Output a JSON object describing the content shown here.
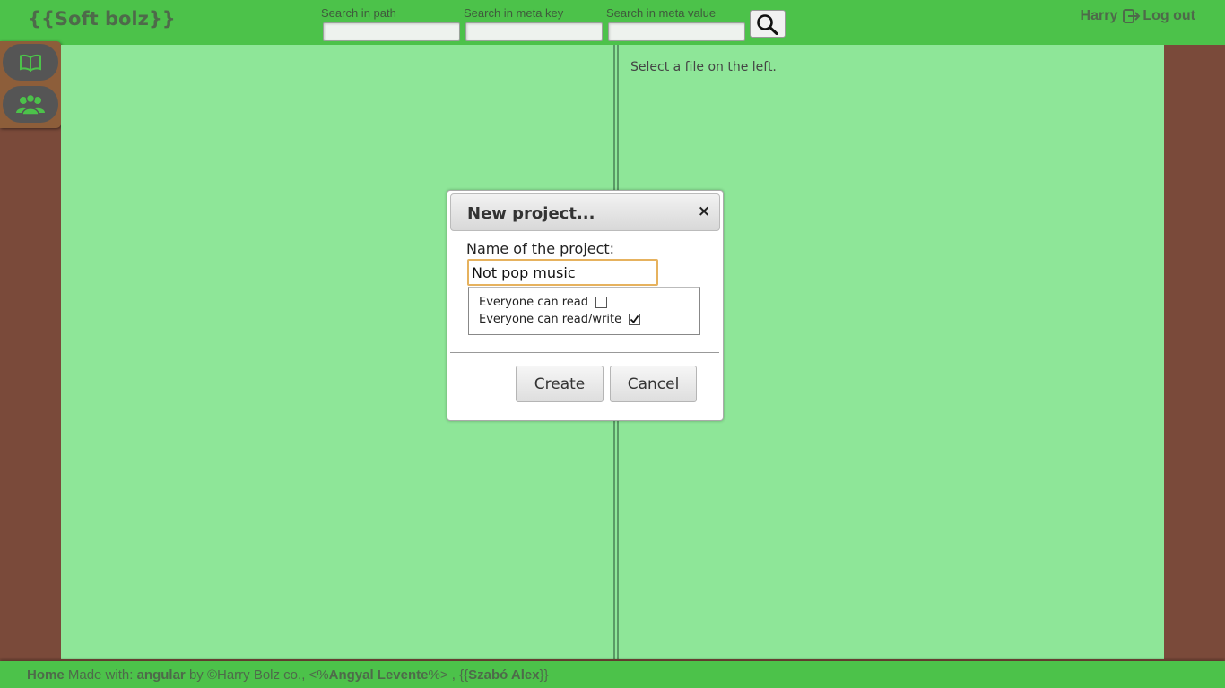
{
  "app": {
    "logo": "{{Soft bolz}}"
  },
  "header": {
    "search_path_label": "Search in path",
    "search_key_label": "Search in meta key",
    "search_value_label": "Search in meta value",
    "search_path_value": "",
    "search_key_value": "",
    "search_value_value": "",
    "search_icon": "search-icon",
    "user_name": "Harry",
    "logout_icon": "logout-icon",
    "logout_label": "Log out"
  },
  "sidebar": {
    "items": [
      {
        "icon": "book-icon"
      },
      {
        "icon": "users-icon"
      }
    ]
  },
  "main": {
    "right_hint": "Select a file on the left."
  },
  "modal": {
    "title": "New project...",
    "close_label": "×",
    "name_label": "Name of the project:",
    "name_value": "Not pop music",
    "options": [
      {
        "label": "Everyone can read",
        "checked": false
      },
      {
        "label": "Everyone can read/write",
        "checked": true
      }
    ],
    "create_label": "Create",
    "cancel_label": "Cancel"
  },
  "footer": {
    "home": "Home",
    "made_with": "Made with:",
    "framework": "angular",
    "by": "by ©Harry Bolz co., <%",
    "author1": "Angyal Levente",
    "sep": "%> , {{",
    "author2": "Szabó Alex",
    "end": "}}"
  },
  "colors": {
    "topbar": "#4cc24a",
    "panel": "#8ee698",
    "frame": "#7a4a3a",
    "sidemenu": "#8d5e3a",
    "focus": "#e6b25e"
  }
}
